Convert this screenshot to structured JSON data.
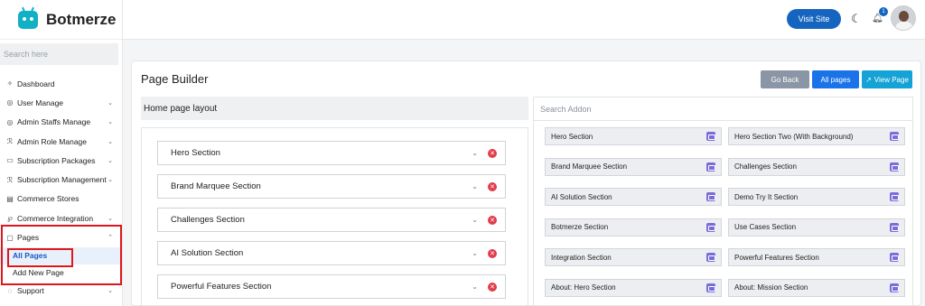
{
  "brand": {
    "name": "Botmerze"
  },
  "sidebar": {
    "search_placeholder": "Search here",
    "items": [
      {
        "label": "Dashboard",
        "icon": "dashboard-icon",
        "glyph": "✧",
        "chevron": ""
      },
      {
        "label": "User Manage",
        "icon": "user-icon",
        "glyph": "◎",
        "chevron": "⌄"
      },
      {
        "label": "Admin Staffs Manage",
        "icon": "staff-icon",
        "glyph": "◎",
        "chevron": "⌄"
      },
      {
        "label": "Admin Role Manage",
        "icon": "role-icon",
        "glyph": "ℛ",
        "chevron": "⌄"
      },
      {
        "label": "Subscription Packages",
        "icon": "package-icon",
        "glyph": "▭",
        "chevron": "⌄"
      },
      {
        "label": "Subscription Management",
        "icon": "subscription-icon",
        "glyph": "ℛ",
        "chevron": "⌄"
      },
      {
        "label": "Commerce Stores",
        "icon": "store-icon",
        "glyph": "▤",
        "chevron": ""
      },
      {
        "label": "Commerce Integration",
        "icon": "integration-icon",
        "glyph": "℘",
        "chevron": "⌄"
      },
      {
        "label": "Pages",
        "icon": "pages-icon",
        "glyph": "▢",
        "chevron": "⌃"
      }
    ],
    "pages_sub": [
      {
        "label": "All Pages",
        "active": true
      },
      {
        "label": "Add New Page",
        "active": false
      }
    ],
    "support": {
      "label": "Support",
      "icon": "support-icon",
      "glyph": "◌",
      "chevron": "⌄"
    }
  },
  "topbar": {
    "visit_site": "Visit Site",
    "notification_count": "1"
  },
  "main": {
    "title": "Page Builder",
    "buttons": {
      "go_back": "Go Back",
      "all_pages": "All pages",
      "view_page": "View Page"
    },
    "layout_title": "Home page layout",
    "sections": [
      "Hero Section",
      "Brand Marquee Section",
      "Challenges Section",
      "AI Solution Section",
      "Powerful Features Section"
    ],
    "addon_search_placeholder": "Search Addon",
    "addons": [
      [
        "Hero Section",
        "Hero Section Two (With Background)"
      ],
      [
        "Brand Marquee Section",
        "Challenges Section"
      ],
      [
        "AI Solution Section",
        "Demo Try It Section"
      ],
      [
        "Botmerze Section",
        "Use Cases Section"
      ],
      [
        "Integration Section",
        "Powerful Features Section"
      ],
      [
        "About: Hero Section",
        "About: Mission Section"
      ]
    ]
  },
  "colors": {
    "primary": "#1565c0",
    "highlight_border": "#e0161b",
    "delete": "#e03c4b",
    "addon_button": "#7a6cd9",
    "logo": "#12b0c4"
  }
}
